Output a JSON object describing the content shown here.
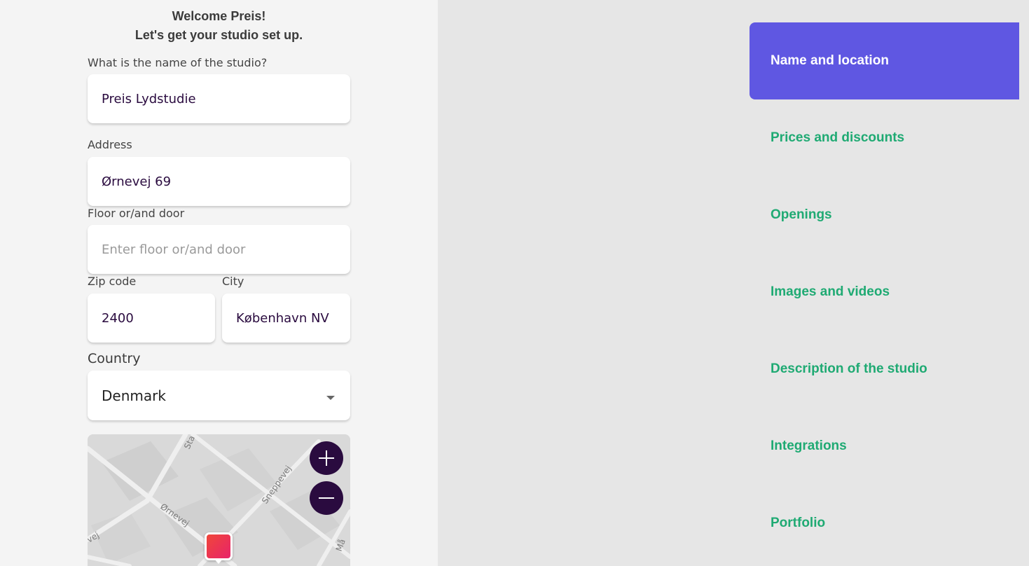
{
  "heading": {
    "line1": "Welcome Preis!",
    "line2": "Let's get your studio set up."
  },
  "form": {
    "studio_name": {
      "label": "What is the name of the studio?",
      "value": "Preis Lydstudie"
    },
    "address": {
      "label": "Address",
      "value": "Ørnevej 69"
    },
    "floor": {
      "label": "Floor or/and door",
      "value": "",
      "placeholder": "Enter floor or/and door"
    },
    "zip": {
      "label": "Zip code",
      "value": "2400"
    },
    "city": {
      "label": "City",
      "value": "København NV"
    },
    "country": {
      "label": "Country",
      "selected": "Denmark"
    }
  },
  "map": {
    "street_labels": [
      "Sta",
      "Sneppevej",
      "Ørnevej",
      "vej",
      "Må"
    ],
    "zoom_in_icon": "plus-icon",
    "zoom_out_icon": "minus-icon"
  },
  "nav": {
    "items": [
      {
        "label": "Name and location",
        "active": true
      },
      {
        "label": "Prices and discounts",
        "active": false
      },
      {
        "label": "Openings",
        "active": false
      },
      {
        "label": "Images and videos",
        "active": false
      },
      {
        "label": "Description of the studio",
        "active": false
      },
      {
        "label": "Integrations",
        "active": false
      },
      {
        "label": "Portfolio",
        "active": false
      }
    ]
  },
  "colors": {
    "accent": "#5f57e2",
    "nav_text": "#1faa73",
    "dark_purple": "#2a0b3f",
    "pin_start": "#f0473a",
    "pin_end": "#e8236a"
  }
}
